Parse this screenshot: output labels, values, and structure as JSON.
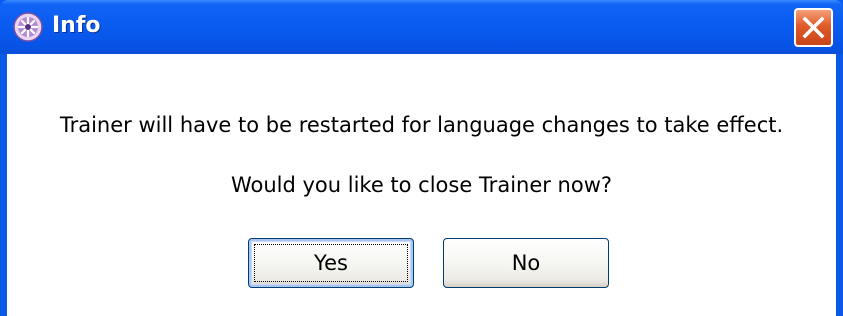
{
  "window": {
    "title": "Info",
    "icon": "app-snowflake-icon",
    "close_icon": "close-x-icon"
  },
  "dialog": {
    "message_line1": "Trainer will have to be restarted for language changes to take effect.",
    "message_line2": "Would you like to close Trainer now?"
  },
  "buttons": {
    "yes_label": "Yes",
    "no_label": "No"
  },
  "colors": {
    "titlebar": "#0a5cf1",
    "close_button": "#e05b2a",
    "body": "#ffffff"
  }
}
